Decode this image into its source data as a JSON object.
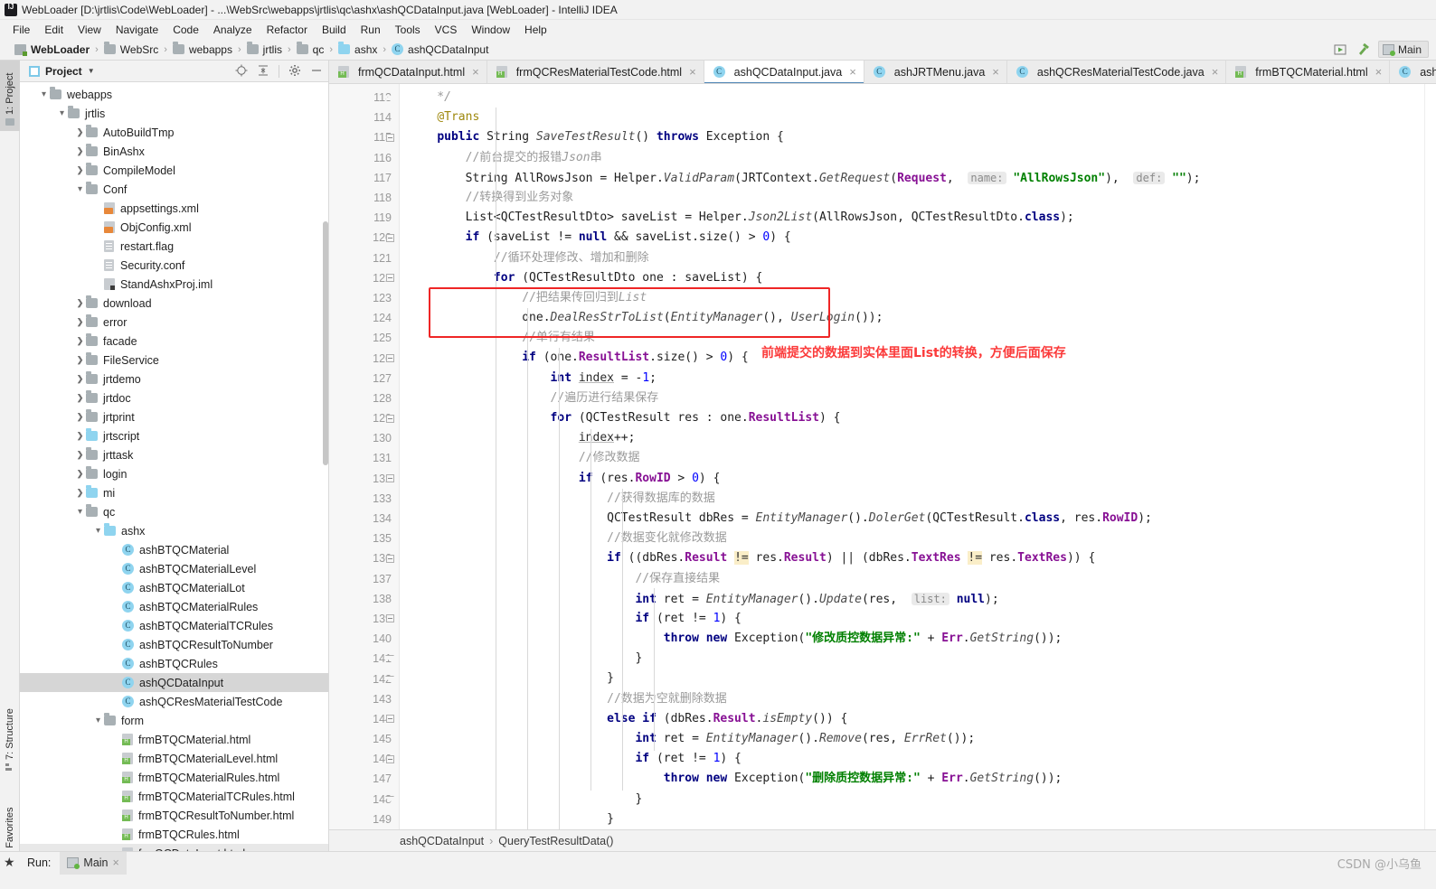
{
  "window": {
    "title": "WebLoader [D:\\jrtlis\\Code\\WebLoader] - ...\\WebSrc\\webapps\\jrtlis\\qc\\ashx\\ashQCDataInput.java [WebLoader] - IntelliJ IDEA",
    "logo_icon": "intellij-idea-logo"
  },
  "menubar": {
    "items": [
      "File",
      "Edit",
      "View",
      "Navigate",
      "Code",
      "Analyze",
      "Refactor",
      "Build",
      "Run",
      "Tools",
      "VCS",
      "Window",
      "Help"
    ]
  },
  "navbar": {
    "crumbs": [
      {
        "label": "WebLoader",
        "icon": "module-icon",
        "bold": true
      },
      {
        "label": "WebSrc",
        "icon": "folder-icon",
        "bold": false
      },
      {
        "label": "webapps",
        "icon": "folder-icon",
        "bold": false
      },
      {
        "label": "jrtlis",
        "icon": "folder-icon",
        "bold": false
      },
      {
        "label": "qc",
        "icon": "folder-icon",
        "bold": false
      },
      {
        "label": "ashx",
        "icon": "folder-icon-blue",
        "bold": false
      },
      {
        "label": "ashQCDataInput",
        "icon": "class-icon",
        "bold": false
      }
    ],
    "separator": "›",
    "run_button_icon": "run-icon",
    "build_button_icon": "hammer-icon",
    "run_config_label": "Main",
    "run_config_icon": "run-config-icon"
  },
  "leftstrip": {
    "tabs": [
      {
        "label": "1: Project",
        "icon": "project-folder-icon",
        "active": true
      },
      {
        "label": "7: Structure",
        "icon": "structure-icon",
        "active": false
      },
      {
        "label": "2: Favorites",
        "icon": "favorites-star-icon",
        "active": false
      }
    ]
  },
  "project_panel": {
    "title": "Project",
    "caret_icon": "chevron-down-icon",
    "tools": [
      "locate-icon",
      "collapse-all-icon",
      "settings-gear-icon",
      "hide-icon"
    ],
    "tree": [
      {
        "depth": 1,
        "arrow": "down",
        "icon": "folder-icon",
        "label": "webapps"
      },
      {
        "depth": 2,
        "arrow": "down",
        "icon": "folder-icon",
        "label": "jrtlis"
      },
      {
        "depth": 3,
        "arrow": "right",
        "icon": "folder-icon",
        "label": "AutoBuildTmp"
      },
      {
        "depth": 3,
        "arrow": "right",
        "icon": "folder-icon",
        "label": "BinAshx"
      },
      {
        "depth": 3,
        "arrow": "right",
        "icon": "folder-icon",
        "label": "CompileModel"
      },
      {
        "depth": 3,
        "arrow": "down",
        "icon": "folder-icon",
        "label": "Conf"
      },
      {
        "depth": 4,
        "arrow": "none",
        "icon": "xml-file-icon",
        "label": "appsettings.xml"
      },
      {
        "depth": 4,
        "arrow": "none",
        "icon": "xml-file-icon",
        "label": "ObjConfig.xml"
      },
      {
        "depth": 4,
        "arrow": "none",
        "icon": "text-file-icon",
        "label": "restart.flag"
      },
      {
        "depth": 4,
        "arrow": "none",
        "icon": "text-file-icon",
        "label": "Security.conf"
      },
      {
        "depth": 4,
        "arrow": "none",
        "icon": "iml-file-icon",
        "label": "StandAshxProj.iml"
      },
      {
        "depth": 3,
        "arrow": "right",
        "icon": "folder-icon",
        "label": "download"
      },
      {
        "depth": 3,
        "arrow": "right",
        "icon": "folder-icon",
        "label": "error"
      },
      {
        "depth": 3,
        "arrow": "right",
        "icon": "folder-icon",
        "label": "facade"
      },
      {
        "depth": 3,
        "arrow": "right",
        "icon": "folder-icon",
        "label": "FileService"
      },
      {
        "depth": 3,
        "arrow": "right",
        "icon": "folder-icon",
        "label": "jrtdemo"
      },
      {
        "depth": 3,
        "arrow": "right",
        "icon": "folder-icon",
        "label": "jrtdoc"
      },
      {
        "depth": 3,
        "arrow": "right",
        "icon": "folder-icon",
        "label": "jrtprint"
      },
      {
        "depth": 3,
        "arrow": "right",
        "icon": "folder-icon-blue",
        "label": "jrtscript"
      },
      {
        "depth": 3,
        "arrow": "right",
        "icon": "folder-icon",
        "label": "jrttask"
      },
      {
        "depth": 3,
        "arrow": "right",
        "icon": "folder-icon",
        "label": "login"
      },
      {
        "depth": 3,
        "arrow": "right",
        "icon": "folder-icon-blue",
        "label": "mi"
      },
      {
        "depth": 3,
        "arrow": "down",
        "icon": "folder-icon",
        "label": "qc"
      },
      {
        "depth": 4,
        "arrow": "down",
        "icon": "folder-icon-blue",
        "label": "ashx"
      },
      {
        "depth": 5,
        "arrow": "none",
        "icon": "class-icon",
        "label": "ashBTQCMaterial"
      },
      {
        "depth": 5,
        "arrow": "none",
        "icon": "class-icon",
        "label": "ashBTQCMaterialLevel"
      },
      {
        "depth": 5,
        "arrow": "none",
        "icon": "class-icon",
        "label": "ashBTQCMaterialLot"
      },
      {
        "depth": 5,
        "arrow": "none",
        "icon": "class-icon",
        "label": "ashBTQCMaterialRules"
      },
      {
        "depth": 5,
        "arrow": "none",
        "icon": "class-icon",
        "label": "ashBTQCMaterialTCRules"
      },
      {
        "depth": 5,
        "arrow": "none",
        "icon": "class-icon",
        "label": "ashBTQCResultToNumber"
      },
      {
        "depth": 5,
        "arrow": "none",
        "icon": "class-icon",
        "label": "ashBTQCRules"
      },
      {
        "depth": 5,
        "arrow": "none",
        "icon": "class-icon",
        "label": "ashQCDataInput",
        "selected": true
      },
      {
        "depth": 5,
        "arrow": "none",
        "icon": "class-icon",
        "label": "ashQCResMaterialTestCode"
      },
      {
        "depth": 4,
        "arrow": "down",
        "icon": "folder-icon",
        "label": "form"
      },
      {
        "depth": 5,
        "arrow": "none",
        "icon": "html-file-icon",
        "label": "frmBTQCMaterial.html"
      },
      {
        "depth": 5,
        "arrow": "none",
        "icon": "html-file-icon",
        "label": "frmBTQCMaterialLevel.html"
      },
      {
        "depth": 5,
        "arrow": "none",
        "icon": "html-file-icon",
        "label": "frmBTQCMaterialRules.html"
      },
      {
        "depth": 5,
        "arrow": "none",
        "icon": "html-file-icon",
        "label": "frmBTQCMaterialTCRules.html"
      },
      {
        "depth": 5,
        "arrow": "none",
        "icon": "html-file-icon",
        "label": "frmBTQCResultToNumber.html"
      },
      {
        "depth": 5,
        "arrow": "none",
        "icon": "html-file-icon",
        "label": "frmBTQCRules.html"
      },
      {
        "depth": 5,
        "arrow": "none",
        "icon": "html-file-icon",
        "label": "frmQCDataInput.html",
        "sel_light": true
      }
    ]
  },
  "editor": {
    "tabs": [
      {
        "label": "frmQCDataInput.html",
        "icon": "html-file-icon",
        "active": false,
        "closable": true
      },
      {
        "label": "frmQCResMaterialTestCode.html",
        "icon": "html-file-icon",
        "active": false,
        "closable": true
      },
      {
        "label": "ashQCDataInput.java",
        "icon": "class-icon",
        "active": true,
        "closable": true
      },
      {
        "label": "ashJRTMenu.java",
        "icon": "class-icon",
        "active": false,
        "closable": true
      },
      {
        "label": "ashQCResMaterialTestCode.java",
        "icon": "class-icon",
        "active": false,
        "closable": true
      },
      {
        "label": "frmBTQCMaterial.html",
        "icon": "html-file-icon",
        "active": false,
        "closable": true
      },
      {
        "label": "ashBTQC",
        "icon": "class-icon",
        "active": false,
        "closable": false
      }
    ],
    "close_glyph": "×",
    "first_line_number": 113,
    "line_numbers": [
      113,
      114,
      115,
      116,
      117,
      118,
      119,
      120,
      121,
      122,
      123,
      124,
      125,
      126,
      127,
      128,
      129,
      130,
      131,
      132,
      133,
      134,
      135,
      136,
      137,
      138,
      139,
      140,
      141,
      142,
      143,
      144,
      145,
      146,
      147,
      148,
      149
    ],
    "breadcrumb": [
      "ashQCDataInput",
      "QueryTestResultData()"
    ],
    "breadcrumb_separator": "›",
    "annotation": {
      "text": "前端提交的数据到实体里面List的转换，方便后面保存",
      "color": "#fb3a3a",
      "box_color": "#ef2626"
    }
  },
  "statusbar": {
    "run_label": "Run:",
    "run_tab_label": "Main",
    "run_tab_icon": "run-config-icon",
    "close_glyph": "×",
    "watermark": "CSDN @小乌鱼"
  }
}
